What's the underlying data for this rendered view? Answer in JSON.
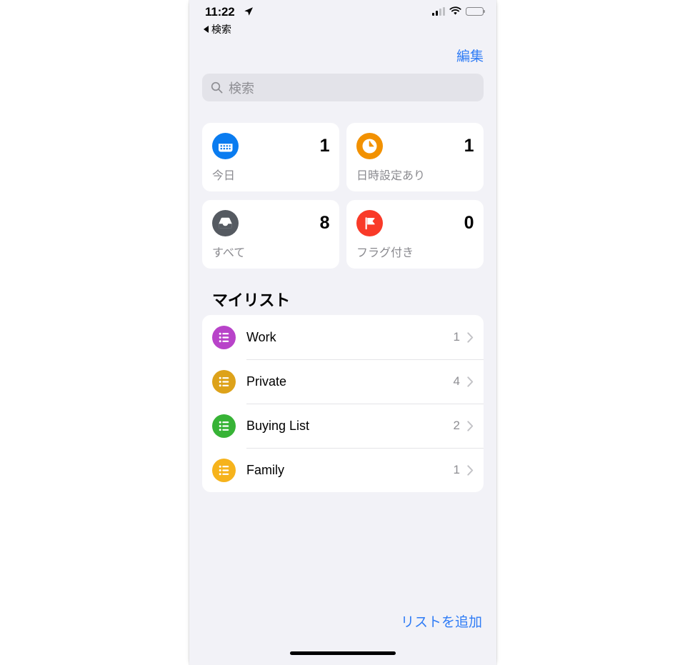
{
  "status_bar": {
    "time": "11:22",
    "location_icon": "location-arrow-icon",
    "signal_icon": "cellular-signal-icon",
    "wifi_icon": "wifi-icon",
    "battery_icon": "battery-full-icon"
  },
  "back": {
    "label": "検索",
    "icon": "back-triangle-icon"
  },
  "nav": {
    "edit_label": "編集",
    "accent_color": "#2f7cf6"
  },
  "search": {
    "placeholder": "検索",
    "icon": "search-icon"
  },
  "smart_lists": [
    {
      "label": "今日",
      "count": "1",
      "icon": "calendar-icon",
      "color": "#0a7cf0"
    },
    {
      "label": "日時設定あり",
      "count": "1",
      "icon": "clock-icon",
      "color": "#f29100"
    },
    {
      "label": "すべて",
      "count": "8",
      "icon": "inbox-tray-icon",
      "color": "#555a61"
    },
    {
      "label": "フラグ付き",
      "count": "0",
      "icon": "flag-icon",
      "color": "#f93a28"
    }
  ],
  "my_lists": {
    "header": "マイリスト",
    "items": [
      {
        "name": "Work",
        "count": "1",
        "icon": "bullet-list-icon",
        "color": "#b843c9"
      },
      {
        "name": "Private",
        "count": "4",
        "icon": "bullet-list-icon",
        "color": "#dda21a"
      },
      {
        "name": "Buying List",
        "count": "2",
        "icon": "bullet-list-icon",
        "color": "#37b336"
      },
      {
        "name": "Family",
        "count": "1",
        "icon": "bullet-list-icon",
        "color": "#f6b31c"
      }
    ]
  },
  "footer": {
    "add_list_label": "リストを追加"
  }
}
